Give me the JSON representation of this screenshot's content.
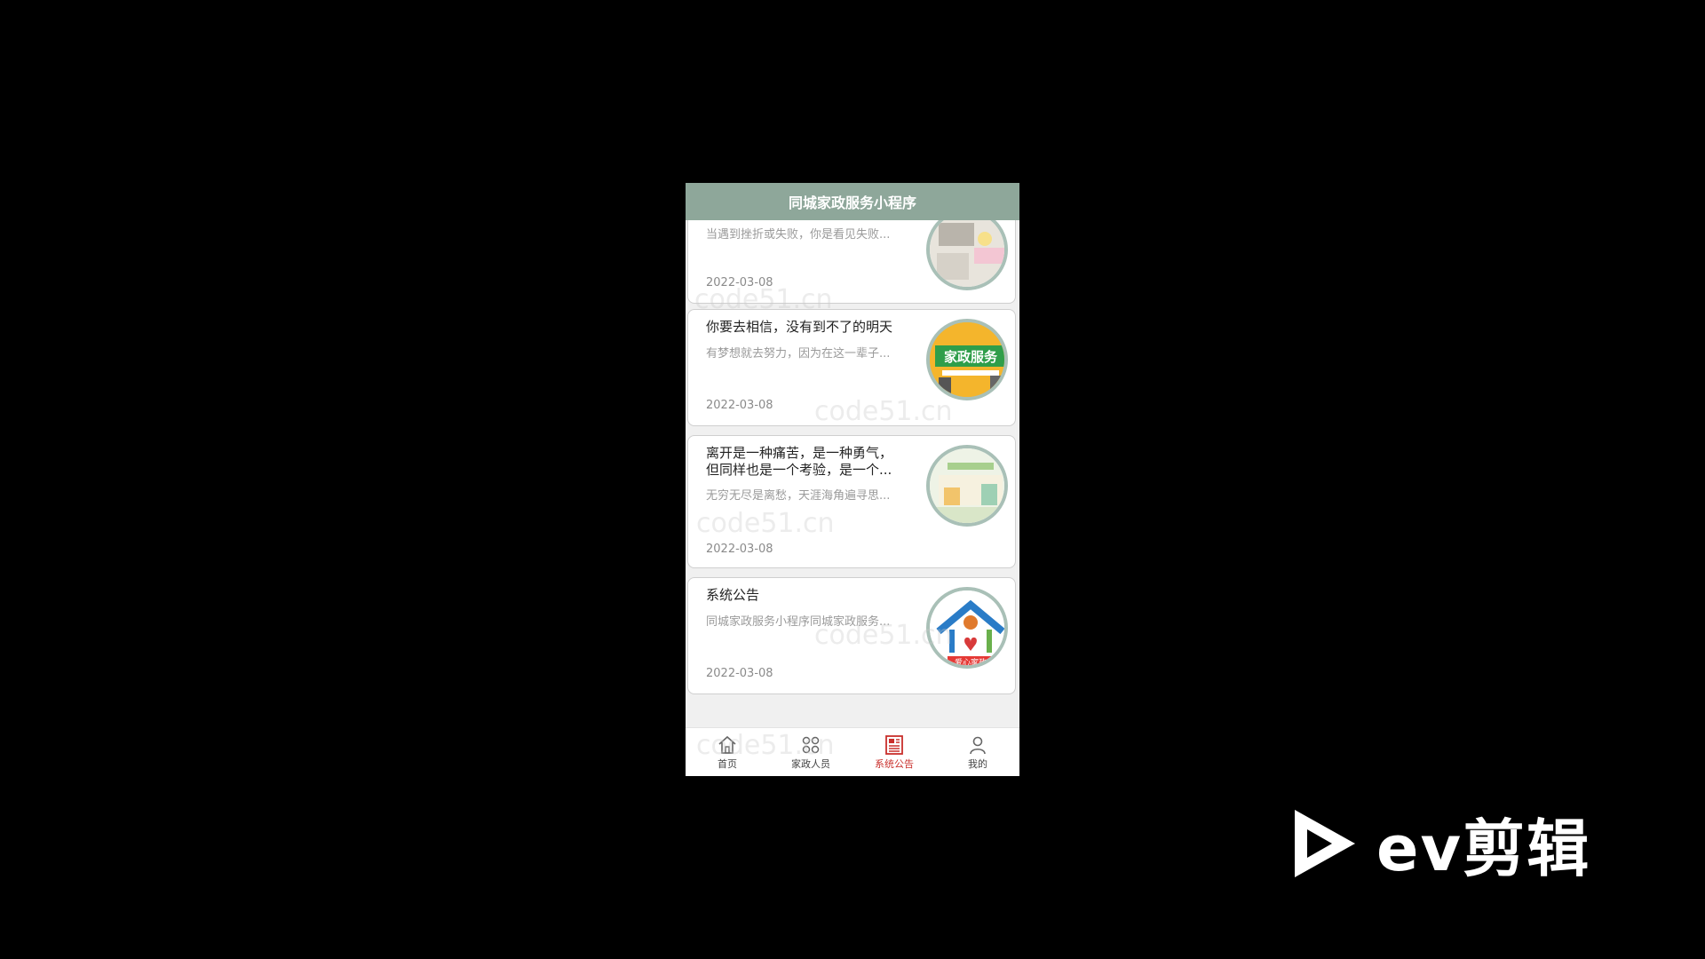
{
  "app": {
    "title": "同城家政服务小程序"
  },
  "notices": [
    {
      "title": "",
      "desc": "当遇到挫折或失败，你是看见失败...",
      "date": "2022-03-08"
    },
    {
      "title": "你要去相信，没有到不了的明天",
      "desc": "有梦想就去努力，因为在这一辈子...",
      "date": "2022-03-08",
      "thumb_text": "家政服务"
    },
    {
      "title": "离开是一种痛苦，是一种勇气，但同样也是一个考验，是一个...",
      "desc": "无穷无尽是离愁，天涯海角遍寻思...",
      "date": "2022-03-08"
    },
    {
      "title": "系统公告",
      "desc": "同城家政服务小程序同城家政服务...",
      "date": "2022-03-08",
      "thumb_text": "爱心家政"
    }
  ],
  "tabbar": [
    {
      "label": "首页",
      "icon": "home-icon"
    },
    {
      "label": "家政人员",
      "icon": "grid-icon"
    },
    {
      "label": "系统公告",
      "icon": "news-icon",
      "active": true
    },
    {
      "label": "我的",
      "icon": "user-icon"
    }
  ],
  "watermark": "code51.cn",
  "overlay": {
    "brand": "ev剪辑"
  },
  "colors": {
    "header": "#8ea79a",
    "active_tab": "#c9302c",
    "thumb_border": "#a9c0b7"
  }
}
